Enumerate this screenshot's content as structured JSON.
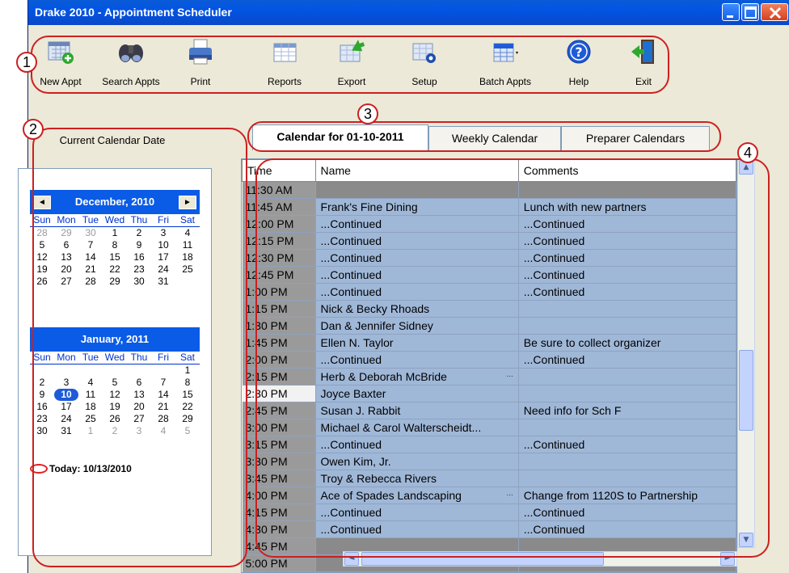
{
  "window": {
    "title": "Drake 2010 - Appointment Scheduler"
  },
  "toolbar": [
    {
      "label": "New Appt",
      "icon": "new-appointment-icon"
    },
    {
      "label": "Search Appts",
      "icon": "binoculars-icon"
    },
    {
      "label": "Print",
      "icon": "printer-icon"
    },
    {
      "label": "Reports",
      "icon": "reports-icon"
    },
    {
      "label": "Export",
      "icon": "export-icon"
    },
    {
      "label": "Setup",
      "icon": "setup-gear-icon"
    },
    {
      "label": "Batch Appts",
      "icon": "batch-appointments-icon"
    },
    {
      "label": "Help",
      "icon": "help-icon"
    },
    {
      "label": "Exit",
      "icon": "exit-door-icon"
    }
  ],
  "callouts": [
    "1",
    "2",
    "3",
    "4"
  ],
  "left_panel": {
    "header": "Current Calendar Date",
    "calendars": [
      {
        "month": "December, 2010",
        "prev": "◄",
        "next": "►",
        "dow": [
          "Sun",
          "Mon",
          "Tue",
          "Wed",
          "Thu",
          "Fri",
          "Sat"
        ],
        "weeks": [
          [
            "28",
            "29",
            "30",
            "1",
            "2",
            "3",
            "4"
          ],
          [
            "5",
            "6",
            "7",
            "8",
            "9",
            "10",
            "11"
          ],
          [
            "12",
            "13",
            "14",
            "15",
            "16",
            "17",
            "18"
          ],
          [
            "19",
            "20",
            "21",
            "22",
            "23",
            "24",
            "25"
          ],
          [
            "26",
            "27",
            "28",
            "29",
            "30",
            "31",
            ""
          ]
        ]
      },
      {
        "month": "January, 2011",
        "dow": [
          "Sun",
          "Mon",
          "Tue",
          "Wed",
          "Thu",
          "Fri",
          "Sat"
        ],
        "weeks": [
          [
            "",
            "",
            "",
            "",
            "",
            "",
            "1"
          ],
          [
            "2",
            "3",
            "4",
            "5",
            "6",
            "7",
            "8"
          ],
          [
            "9",
            "10",
            "11",
            "12",
            "13",
            "14",
            "15"
          ],
          [
            "16",
            "17",
            "18",
            "19",
            "20",
            "21",
            "22"
          ],
          [
            "23",
            "24",
            "25",
            "26",
            "27",
            "28",
            "29"
          ],
          [
            "30",
            "31",
            "1",
            "2",
            "3",
            "4",
            "5"
          ]
        ],
        "selected": "10"
      }
    ],
    "today": "Today: 10/13/2010"
  },
  "tabs": [
    {
      "label": "Calendar for 01-10-2011",
      "active": true
    },
    {
      "label": "Weekly Calendar",
      "active": false
    },
    {
      "label": "Preparer Calendars",
      "active": false
    }
  ],
  "grid": {
    "columns": [
      "Time",
      "Name",
      "Comments"
    ],
    "rows": [
      {
        "time": "11:30 AM",
        "name": "",
        "comment": ""
      },
      {
        "time": "11:45 AM",
        "name": "Frank's Fine Dining",
        "comment": "Lunch with new partners"
      },
      {
        "time": "12:00 PM",
        "name": "...Continued",
        "comment": "...Continued"
      },
      {
        "time": "12:15 PM",
        "name": "...Continued",
        "comment": "...Continued"
      },
      {
        "time": "12:30 PM",
        "name": "...Continued",
        "comment": "...Continued"
      },
      {
        "time": "12:45 PM",
        "name": "...Continued",
        "comment": "...Continued"
      },
      {
        "time": "1:00 PM",
        "name": "...Continued",
        "comment": "...Continued"
      },
      {
        "time": "1:15 PM",
        "name": "Nick & Becky Rhoads",
        "comment": ""
      },
      {
        "time": "1:30 PM",
        "name": "Dan & Jennifer Sidney",
        "comment": ""
      },
      {
        "time": "1:45 PM",
        "name": "Ellen N. Taylor",
        "comment": "Be sure to collect organizer"
      },
      {
        "time": "2:00 PM",
        "name": "...Continued",
        "comment": "...Continued"
      },
      {
        "time": "2:15 PM",
        "name": "Herb & Deborah McBride",
        "comment": "",
        "more": "..."
      },
      {
        "time": "2:30 PM",
        "name": "Joyce Baxter",
        "comment": ""
      },
      {
        "time": "2:45 PM",
        "name": "Susan J. Rabbit",
        "comment": "Need info for Sch F"
      },
      {
        "time": "3:00 PM",
        "name": "Michael & Carol Walterscheidt...",
        "comment": ""
      },
      {
        "time": "3:15 PM",
        "name": "...Continued",
        "comment": "...Continued"
      },
      {
        "time": "3:30 PM",
        "name": "Owen Kim, Jr.",
        "comment": ""
      },
      {
        "time": "3:45 PM",
        "name": "Troy & Rebecca Rivers",
        "comment": ""
      },
      {
        "time": "4:00 PM",
        "name": "Ace of Spades Landscaping",
        "comment": "Change from 1120S to Partnership",
        "more": "..."
      },
      {
        "time": "4:15 PM",
        "name": "...Continued",
        "comment": "...Continued"
      },
      {
        "time": "4:30 PM",
        "name": "...Continued",
        "comment": "...Continued"
      },
      {
        "time": "4:45 PM",
        "name": "",
        "comment": ""
      },
      {
        "time": "5:00 PM",
        "name": "",
        "comment": ""
      }
    ],
    "current_time": "2:30 PM"
  },
  "colors": {
    "title_bar": "#0254e4",
    "callout_red": "#cc2020",
    "appointment_fill": "#a0b8d8",
    "time_fill": "#9a9a9a"
  }
}
